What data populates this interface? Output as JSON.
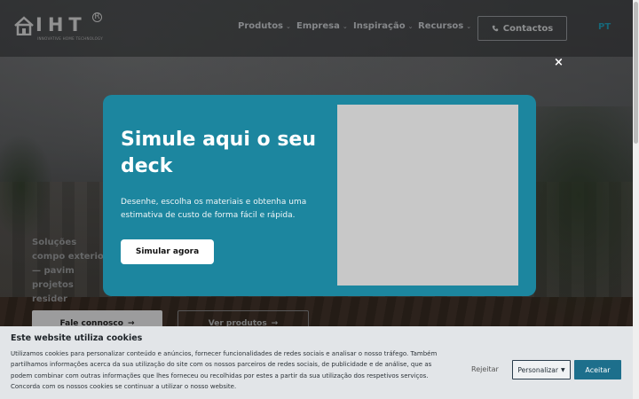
{
  "header": {
    "logo_text": "IHT",
    "logo_subtitle": "INNOVATIVE HOME TECHNOLOGY",
    "logo_reg": "R",
    "nav": [
      {
        "label": "Produtos",
        "icon": "chevron-down-icon"
      },
      {
        "label": "Empresa",
        "icon": "chevron-down-icon"
      },
      {
        "label": "Inspiração",
        "icon": "chevron-down-icon"
      },
      {
        "label": "Recursos",
        "icon": "chevron-down-icon"
      }
    ],
    "contact_label": "Contactos",
    "contact_icon": "phone-icon",
    "language": "PT"
  },
  "hero": {
    "text": "Soluções compo exterior — pavim projetos resider",
    "primary_button": "Fale connosco",
    "secondary_button": "Ver produtos",
    "arrow": "→"
  },
  "modal": {
    "title": "Simule aqui o seu deck",
    "description": "Desenhe, escolha os materiais e obtenha uma estimativa de custo de forma fácil e rápida.",
    "button": "Simular agora",
    "close": "×",
    "accent": "#1c869f"
  },
  "cookie": {
    "title": "Este website utiliza cookies",
    "text": "Utilizamos cookies para personalizar conteúdo e anúncios, fornecer funcionalidades de redes sociais e analisar o nosso tráfego. Também partilhamos informações acerca da sua utilização do site com os nossos parceiros de redes sociais, de publicidade e de análise, que as podem combinar com outras informações que lhes forneceu ou recolhidas por estes a partir da sua utilização dos respetivos serviços. Concorda com os nossos cookies se continuar a utilizar o nosso website.",
    "reject": "Rejeitar",
    "customize": "Personalizar",
    "accept": "Aceitar",
    "accept_color": "#1d6f8c"
  }
}
